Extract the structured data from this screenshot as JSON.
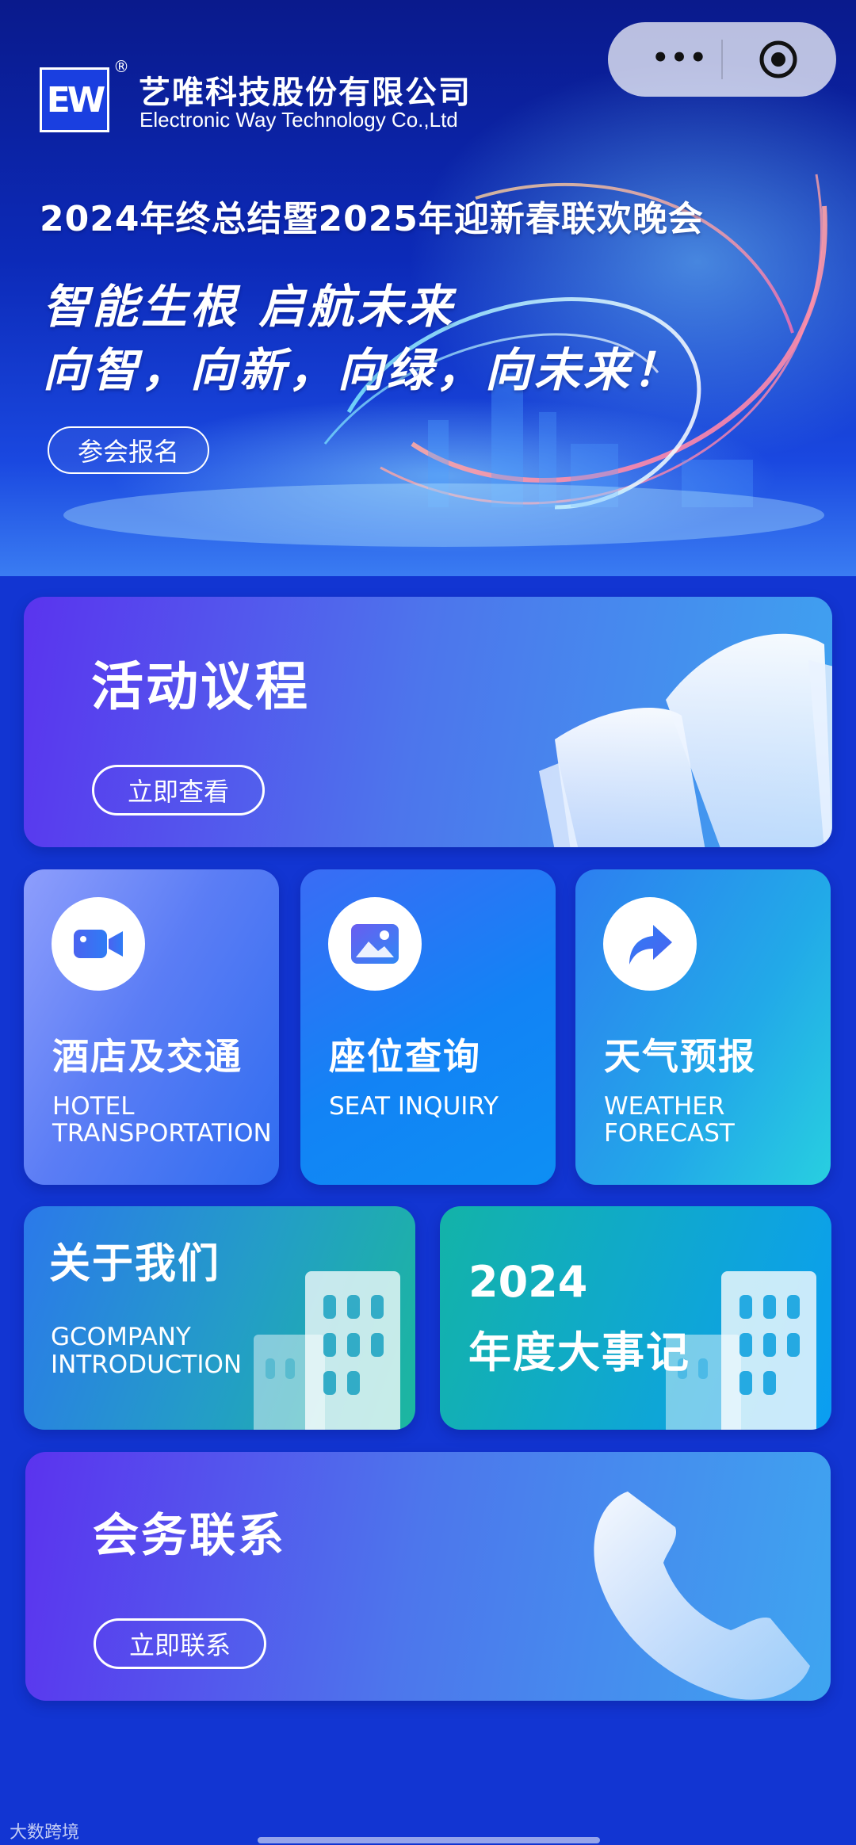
{
  "header": {
    "company_cn": "艺唯科技股份有限公司",
    "company_en": "Electronic Way Technology Co.,Ltd",
    "logo_text": "EW",
    "logo_mark": "®",
    "capsule_more": "•••"
  },
  "hero": {
    "event_title": "2024年终总结暨2025年迎新春联欢晚会",
    "slogan_line1": "智能生根  启航未来",
    "slogan_line2": "向智，向新，向绿，向未来！",
    "signup_label": "参会报名"
  },
  "agenda": {
    "title": "活动议程",
    "button": "立即查看"
  },
  "tiles": [
    {
      "cn": "酒店及交通",
      "en": "HOTEL TRANSPORTATION",
      "icon": "video-camera-icon"
    },
    {
      "cn": "座位查询",
      "en": "SEAT INQUIRY",
      "icon": "image-icon"
    },
    {
      "cn": "天气预报",
      "en": "WEATHER FORECAST",
      "icon": "share-arrow-icon"
    }
  ],
  "about": {
    "cn": "关于我们",
    "en": "GCOMPANY INTRODUCTION"
  },
  "events": {
    "year": "2024",
    "cn": "年度大事记"
  },
  "contact": {
    "title": "会务联系",
    "button": "立即联系"
  },
  "footer": {
    "watermark": "大数跨境"
  },
  "colors": {
    "background": "#1235d2",
    "agenda_start": "#5a34ee",
    "agenda_end": "#3ea3f0"
  }
}
